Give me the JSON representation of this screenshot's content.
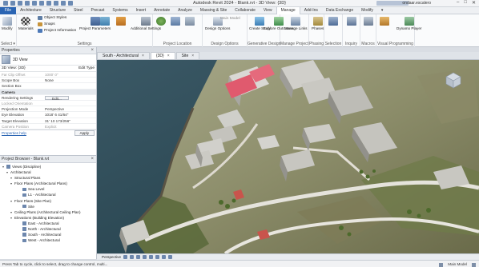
{
  "window": {
    "title": "Autodesk Revit 2024 - Blank.rvt - 3D View: {3D}",
    "user": "ondaar.escalero",
    "controls": [
      "–",
      "□",
      "✕"
    ]
  },
  "ribbon_tabs": [
    "File",
    "Architecture",
    "Structure",
    "Steel",
    "Precast",
    "Systems",
    "Insert",
    "Annotate",
    "Analyze",
    "Massing & Site",
    "Collaborate",
    "View",
    "Manage",
    "Add-Ins",
    "Data Exchange",
    "Modify",
    "▾"
  ],
  "ribbon": {
    "modify": "Modify",
    "select": "Select ▾",
    "settings_group": "Settings",
    "materials": "Materials",
    "object_styles": "Object Styles",
    "snaps": "Snaps",
    "project_information": "Project Information",
    "project_parameters": "Project Parameters",
    "shared": "Shared",
    "transfer": "Transfer Project Standards",
    "purge": "Purge Unused",
    "project_units": "Project Units",
    "global_parameters": "Global Parameters",
    "additional_settings": "Additional Settings",
    "project_location_group": "Project Location",
    "location": "Location",
    "coordinates": "Coordinates",
    "position": "Position",
    "design_options_group": "Design Options",
    "design_options": "Design Options",
    "main_model": "Main Model",
    "generative_group": "Generative Design",
    "create_study": "Create Study",
    "explore_outcomes": "Explore Outcomes",
    "manage_project_group": "Manage Project",
    "manage_links": "Manage Links",
    "phases": "Phases",
    "phasing_group": "Phasing",
    "selection_group": "Selection",
    "inquiry_group": "Inquiry",
    "macros_group": "Macros",
    "visual_programming_group": "Visual Programming",
    "dynamo_player": "Dynamo Player",
    "dynamo": "Dynamo"
  },
  "properties": {
    "title": "Properties",
    "type_name": "3D View",
    "selector": "3D View: {3D}",
    "edit_type": "Edit Type",
    "rows": [
      {
        "k": "Far Clip Offset",
        "v": "1000' 0\"",
        "dim": true
      },
      {
        "k": "Scope Box",
        "v": "None",
        "dim": false
      },
      {
        "k": "Section Box",
        "v": "",
        "dim": false
      },
      {
        "k": "Camera",
        "v": "",
        "hdr": true
      },
      {
        "k": "Rendering Settings",
        "v": "Edit...",
        "btn": true
      },
      {
        "k": "Locked Orientation",
        "v": "",
        "dim": true
      },
      {
        "k": "Projection Mode",
        "v": "Perspective",
        "dim": false
      },
      {
        "k": "Eye Elevation",
        "v": "1018' 6 41/64\"",
        "dim": false
      },
      {
        "k": "Target Elevation",
        "v": "31' 10 173/256\"",
        "dim": false
      },
      {
        "k": "Camera Position",
        "v": "Explicit",
        "dim": true
      }
    ],
    "help": "Properties help",
    "apply": "Apply"
  },
  "browser": {
    "title": "Project Browser - Blank.rvt",
    "items": [
      {
        "label": "Views (Discipline)",
        "level": 0,
        "tw": "▾",
        "icon": true
      },
      {
        "label": "Architectural",
        "level": 1,
        "tw": "▾",
        "icon": false
      },
      {
        "label": "Structural Plans",
        "level": 2,
        "tw": "▾",
        "icon": false
      },
      {
        "label": "Floor Plans (Architectural Plans)",
        "level": 2,
        "tw": "▾",
        "icon": false
      },
      {
        "label": "Sea Level",
        "level": 4,
        "tw": "",
        "icon": true
      },
      {
        "label": "L1 - Architectural",
        "level": 4,
        "tw": "",
        "icon": true
      },
      {
        "label": "Floor Plans (Site Plan)",
        "level": 2,
        "tw": "▾",
        "icon": false
      },
      {
        "label": "Site",
        "level": 4,
        "tw": "",
        "icon": true
      },
      {
        "label": "Ceiling Plans (Architectural Ceiling Plan)",
        "level": 2,
        "tw": "▾",
        "icon": false
      },
      {
        "label": "Elevations (Building Elevation)",
        "level": 2,
        "tw": "▾",
        "icon": false
      },
      {
        "label": "East - Architectural",
        "level": 4,
        "tw": "",
        "icon": true
      },
      {
        "label": "North - Architectural",
        "level": 4,
        "tw": "",
        "icon": true
      },
      {
        "label": "South - Architectural",
        "level": 4,
        "tw": "",
        "icon": true
      },
      {
        "label": "West - Architectural",
        "level": 4,
        "tw": "",
        "icon": true
      }
    ]
  },
  "view_tabs": [
    {
      "label": "South - Architectural",
      "active": false
    },
    {
      "label": "{3D}",
      "active": true
    },
    {
      "label": "Site",
      "active": false
    }
  ],
  "view_control": {
    "projection": "Perspective"
  },
  "status": {
    "text": "Press Tab to cycle, click to select, drag to change control, multi...",
    "model": "Main Model"
  }
}
